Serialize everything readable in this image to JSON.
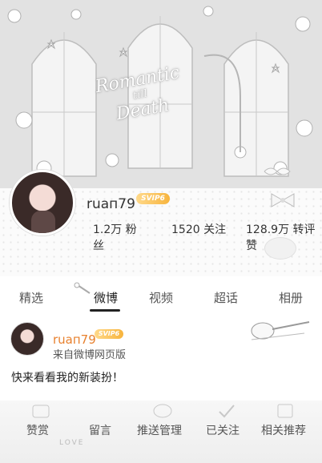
{
  "cover": {
    "title_line1": "Romantic",
    "title_line2": "till",
    "title_line3": "Death"
  },
  "profile": {
    "username": "ruaп79",
    "badge": "SVIP6",
    "stats": [
      {
        "value": "1.2万",
        "label": "粉丝"
      },
      {
        "value": "1520",
        "label": "关注"
      },
      {
        "value": "128.9万",
        "label": "转评赞"
      }
    ]
  },
  "tabs": [
    "精选",
    "微博",
    "视频",
    "超话",
    "相册"
  ],
  "post": {
    "username": "ruaп79",
    "badge": "SVIP6",
    "source": "来自微博网页版",
    "text": "快来看看我的新装扮！"
  },
  "footer": {
    "items": [
      "赞赏",
      "留言",
      "推送管理",
      "已关注",
      "相关推荐"
    ],
    "decor_text": "LOVE"
  },
  "colors": {
    "accent": "#e8812e",
    "badge": "#f7b43d"
  }
}
